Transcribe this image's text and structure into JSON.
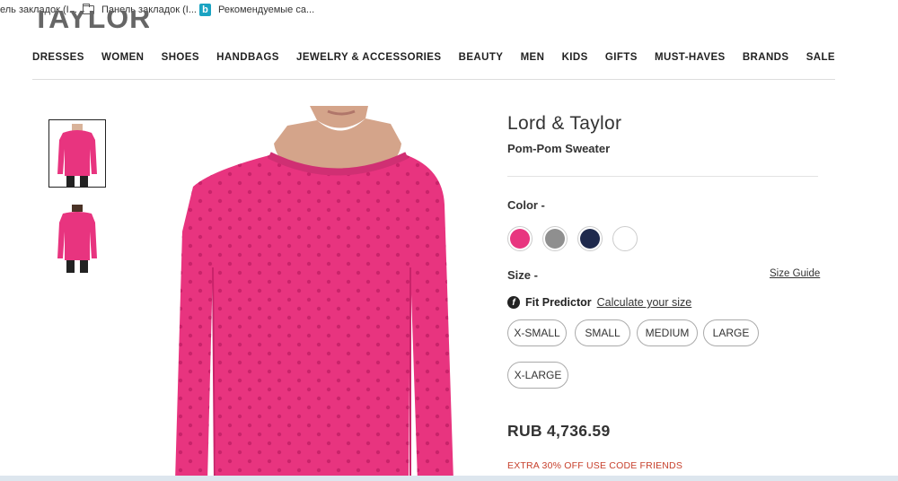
{
  "bookmarks": {
    "item1": "ель закладок (I...",
    "item2": "Панель закладок (I...",
    "item3": "Рекомендуемые са..."
  },
  "logo": {
    "text": "TAYLOR"
  },
  "nav": [
    "DRESSES",
    "WOMEN",
    "SHOES",
    "HANDBAGS",
    "JEWELRY & ACCESSORIES",
    "BEAUTY",
    "MEN",
    "KIDS",
    "GIFTS",
    "MUST-HAVES",
    "BRANDS",
    "SALE"
  ],
  "product": {
    "brand": "Lord & Taylor",
    "name": "Pom-Pom Sweater",
    "color_label": "Color -",
    "swatches": [
      "#e8357f",
      "#8f8f8f",
      "#1f2a4d",
      "#ffffff"
    ],
    "size_label": "Size -",
    "size_guide": "Size Guide",
    "fit_icon": "f",
    "fit_predictor": "Fit Predictor",
    "fit_link": "Calculate your size",
    "sizes": [
      "X-SMALL",
      "SMALL",
      "MEDIUM",
      "LARGE",
      "X-LARGE"
    ],
    "price": "RUB 4,736.59",
    "promo": "EXTRA 30% OFF USE CODE FRIENDS"
  },
  "colors": {
    "sweater": "#e8347f",
    "promo": "#c7402c"
  }
}
